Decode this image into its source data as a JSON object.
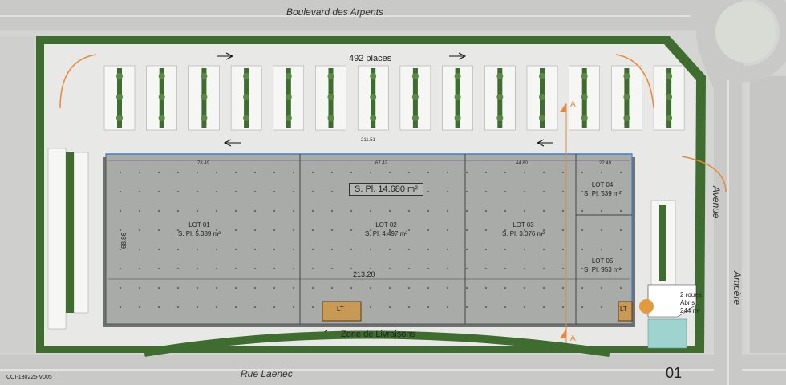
{
  "streets": {
    "north": "Boulevard des Arpents",
    "south": "Rue Laenec",
    "east_upper": "Avenue",
    "east_lower": "Ampère"
  },
  "parking": {
    "label": "492 places",
    "dim": "211.51"
  },
  "building": {
    "total_area": "S. Pl. 14.680 m²",
    "width_dim": "213.20",
    "height_dim": "68.86",
    "segment_dims": [
      "78.49",
      "67.42",
      "44.80",
      "22.49"
    ],
    "lots": [
      {
        "name": "LOT 01",
        "area": "S. Pl. 5.389 m²"
      },
      {
        "name": "LOT 02",
        "area": "S. Pl. 4.497 m²"
      },
      {
        "name": "LOT 03",
        "area": "S. Pl. 3.076 m²"
      },
      {
        "name": "LOT 04",
        "area": "S. Pl. 539 m²"
      },
      {
        "name": "LOT 05",
        "area": "S. Pl. 953 m²"
      }
    ],
    "lt_label": "LT",
    "lt_label_2": "LT"
  },
  "delivery": {
    "label": "Zone de Livraisons"
  },
  "bike": {
    "line1": "2 roues",
    "line2": "Abris",
    "line3": "244 m²"
  },
  "section": {
    "top": "A",
    "bottom": "A"
  },
  "drawing": {
    "code": "COI-130225-V005",
    "sheet": "01"
  },
  "colors": {
    "background": "#d4d4d2",
    "road": "#c9c9c7",
    "parking_lot": "#e8e8e6",
    "building": "#a9aba8",
    "green": "#3f6d2f",
    "orange": "#e8893a",
    "blue_line": "#3a7fd4",
    "water": "#9fd3cf"
  }
}
